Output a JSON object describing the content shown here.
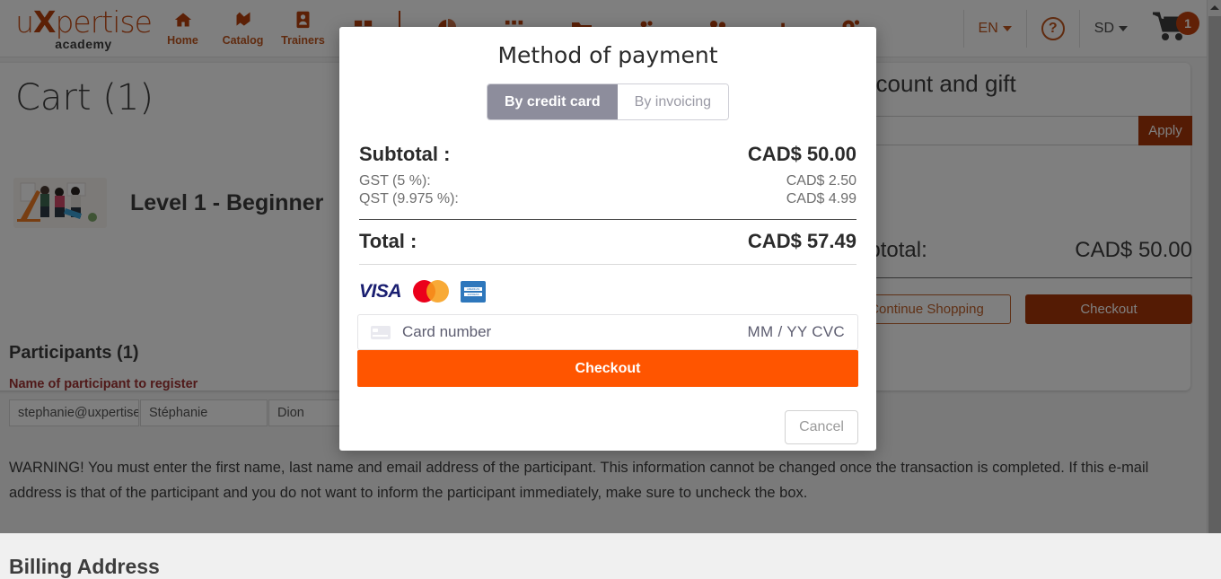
{
  "navbar": {
    "brand": {
      "prefix": "u",
      "accent": "X",
      "rest": "pertise",
      "sub": "academy"
    },
    "items": [
      {
        "label": "Home",
        "icon": "home-icon"
      },
      {
        "label": "Catalog",
        "icon": "catalog-icon"
      },
      {
        "label": "Trainers",
        "icon": "trainers-icon"
      }
    ],
    "icon_only": [
      "dashboard-grid-icon",
      "pie-chart-icon",
      "apps-grid-icon",
      "folder-icon",
      "group-settings-icon",
      "user-badge-icon",
      "bar-chart-icon",
      "settings-gears-icon"
    ],
    "language": "EN",
    "help": "?",
    "user": "SD",
    "cart_count": "1",
    "cart_icon": "shopping-cart-icon"
  },
  "cart": {
    "title": "Cart (1)",
    "course_name": "Level 1 - Beginner",
    "participants_heading": "Participants (1)",
    "participant_field_label": "Name of participant to register",
    "participant": {
      "email": "stephanie@uxpertise",
      "first_name": "Stéphanie",
      "last_name": "Dion"
    },
    "warning": "WARNING! You must enter the first name, last name and email address of the participant. This information cannot be changed once the transaction is completed. If this e-mail address is that of the participant and you do not want to inform the participant immediately, make sure to uncheck the box.",
    "billing_heading": "Billing Address"
  },
  "summary": {
    "title": "Discount and gift",
    "promo_value": "",
    "promo_placeholder": "",
    "apply_label": "Apply",
    "subtotal_label": "Subtotal:",
    "subtotal_value": "CAD$ 50.00",
    "continue_label": "Continue Shopping",
    "checkout_label": "Checkout"
  },
  "modal": {
    "title": "Method of payment",
    "tabs": [
      {
        "label": "By credit card",
        "active": true
      },
      {
        "label": "By invoicing",
        "active": false
      }
    ],
    "lines": {
      "subtotal_label": "Subtotal :",
      "subtotal_value": "CAD$ 50.00",
      "gst_label": "GST (5 %):",
      "gst_value": "CAD$ 2.50",
      "qst_label": "QST (9.975 %):",
      "qst_value": "CAD$ 4.99",
      "total_label": "Total :",
      "total_value": "CAD$ 57.49"
    },
    "card_brands": [
      "visa-logo",
      "mastercard-logo",
      "amex-logo"
    ],
    "visa_text": "VISA",
    "amex_line1": "AMERICAN",
    "amex_line2": "EXPRESS",
    "card_input": {
      "icon": "credit-card-icon",
      "placeholder": "Card number",
      "value": "",
      "expiry_cvc": "MM / YY  CVC"
    },
    "pay_label": "Checkout",
    "cancel_label": "Cancel"
  },
  "colors": {
    "brand_orange": "#b8400c",
    "accent_orange": "#a93709",
    "stripe_orange": "#ff5500",
    "segment_active": "#8d8d9c",
    "warning_red": "#a03232"
  }
}
